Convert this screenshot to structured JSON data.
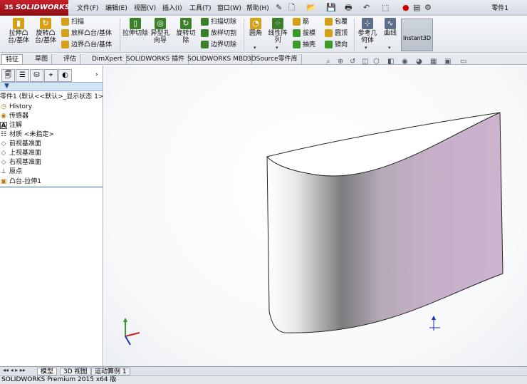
{
  "app": {
    "brand": "SOLIDWORKS",
    "document_title": "零件1"
  },
  "menu": [
    "文件(F)",
    "编辑(E)",
    "视图(V)",
    "插入(I)",
    "工具(T)",
    "窗口(W)",
    "帮助(H)"
  ],
  "ribbon": {
    "extrude_boss": "拉伸凸台/基体",
    "revolve_boss": "旋转凸台/基体",
    "sweep": "扫描",
    "loft_boss": "放样凸台/基体",
    "boundary_boss": "边界凸台/基体",
    "extrude_cut": "拉伸切除",
    "hole_wizard": "异型孔向导",
    "revolve_cut": "旋转切除",
    "swept_cut": "扫描切除",
    "lofted_cut": "放样切割",
    "boundary_cut": "边界切除",
    "fillet": "圆角",
    "linear_pattern": "线性阵列",
    "rib": "筋",
    "draft": "拔模",
    "shell": "抽壳",
    "wrap": "包覆",
    "dome": "圆顶",
    "mirror": "镜向",
    "ref_geometry": "参考几何体",
    "curves": "曲线",
    "instant3d": "Instant3D"
  },
  "tabs": [
    "特征",
    "草图",
    "评估",
    "DimXpert",
    "SOLIDWORKS 插件",
    "SOLIDWORKS MBD",
    "3DSource零件库"
  ],
  "tree": {
    "root": "零件1 (默认<<默认>_显示状态 1>)",
    "items": [
      "History",
      "传感器",
      "注解",
      "材质 <未指定>",
      "前视基准面",
      "上视基准面",
      "右视基准面",
      "原点",
      "凸台-拉伸1"
    ]
  },
  "bottom_tabs": [
    "模型",
    "3D 视图",
    "运动算例 1"
  ],
  "status": "SOLIDWORKS Premium 2015 x64 版",
  "colors": {
    "brand_red": "#c6202a",
    "model_face_light": "#ffffff",
    "model_face_purple": "#c9b0cb",
    "selection_blue": "#2a6ab8"
  }
}
